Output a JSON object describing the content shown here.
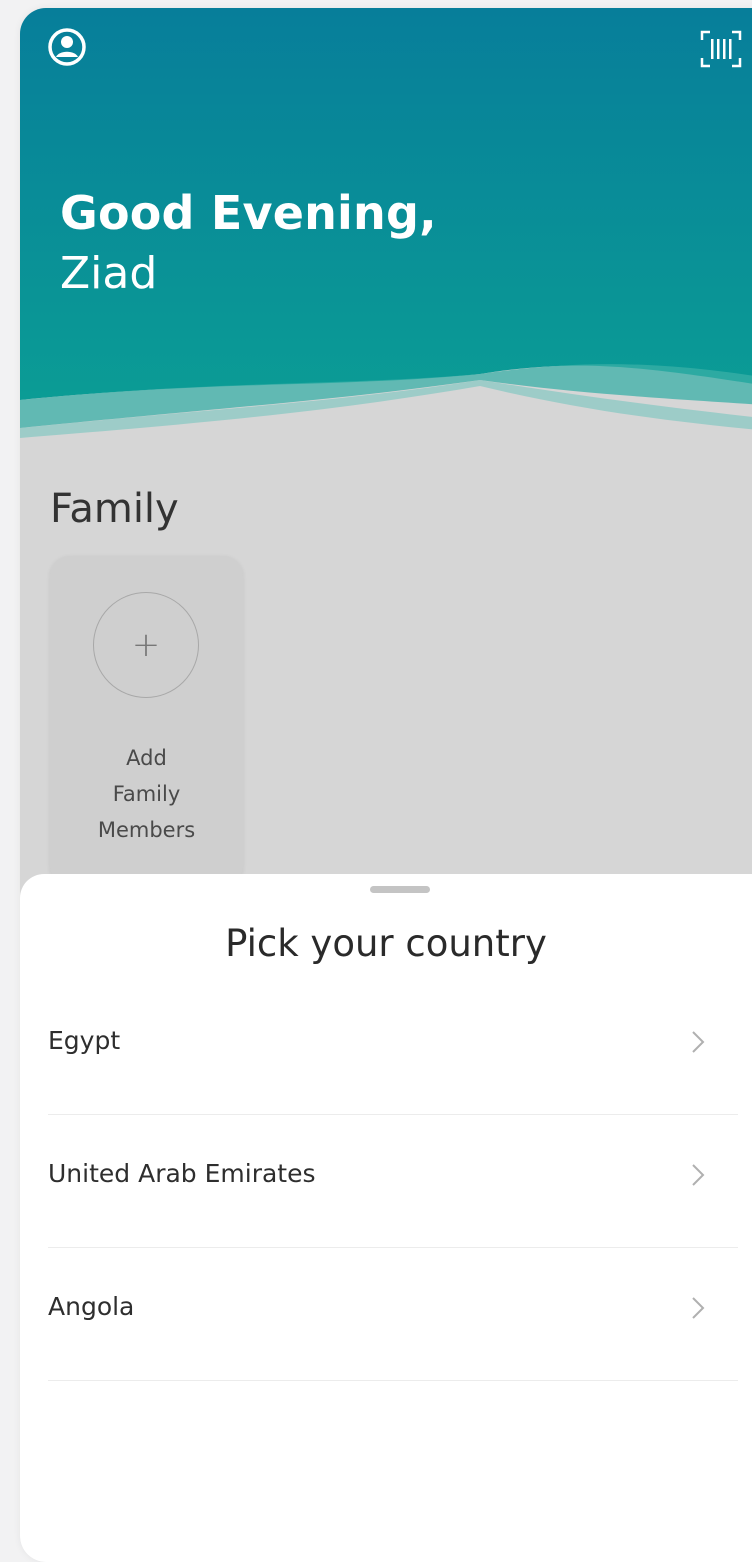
{
  "header": {
    "greeting": "Good Evening,",
    "user_name": "Ziad",
    "profile_icon": "user-circle-icon",
    "scan_icon": "barcode-scan-icon",
    "gradient_top": "#077e9a",
    "gradient_bottom": "#0b9c95"
  },
  "family": {
    "title": "Family",
    "add_card": {
      "icon": "plus-icon",
      "label_line1": "Add",
      "label_line2": "Family",
      "label_line3": "Members"
    }
  },
  "sheet": {
    "title": "Pick your country",
    "countries": [
      {
        "name": "Egypt"
      },
      {
        "name": "United Arab Emirates"
      },
      {
        "name": "Angola"
      }
    ]
  }
}
